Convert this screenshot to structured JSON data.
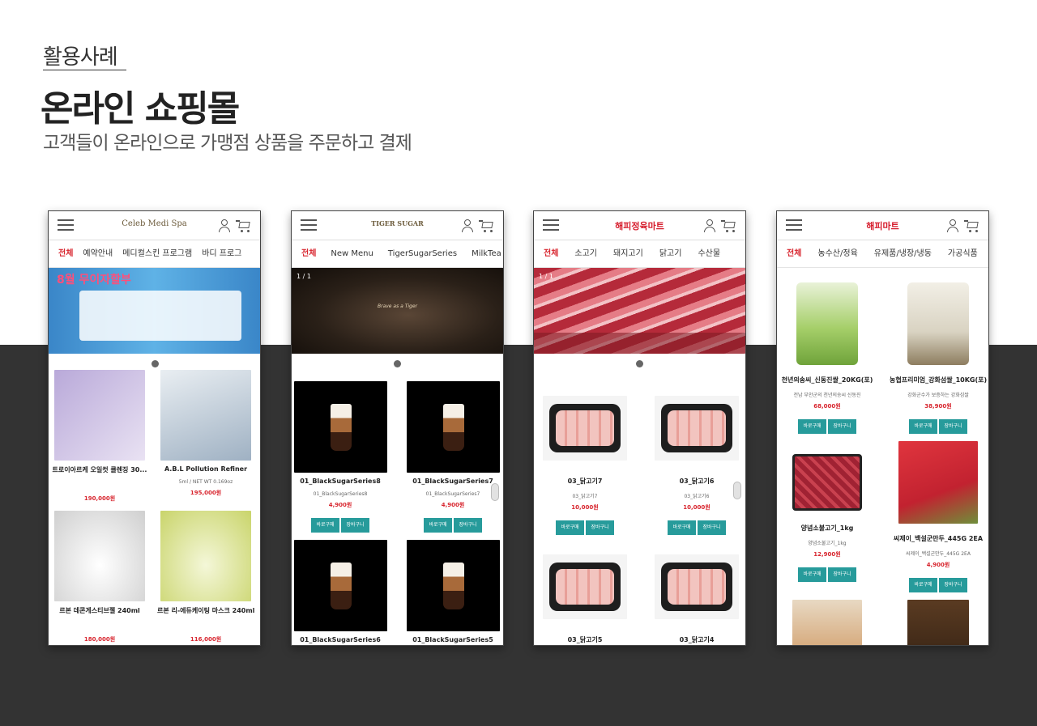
{
  "header": {
    "kicker": "활용사례",
    "title": "온라인 쇼핑몰",
    "subtitle": "고객들이 온라인으로 가맹점 상품을 주문하고 결제"
  },
  "colors": {
    "accent_red": "#d8262f",
    "button_teal": "#279b9b",
    "dark_band": "#333333"
  },
  "icons": {
    "menu": "hamburger-icon",
    "user": "user-icon",
    "cart": "cart-icon"
  },
  "phones": [
    {
      "logo": "Celeb Medi Spa",
      "nav": [
        "전체",
        "예약안내",
        "메디컬스킨 프로그램",
        "바디 프로그"
      ],
      "banner_text": "8월 무이자할부",
      "counter": "",
      "products": [
        {
          "name": "트로이아르케 오일컷 클렌징 30...",
          "desc": "",
          "price": "190,000원"
        },
        {
          "name": "A.B.L Pollution Refiner",
          "desc": "5ml / NET WT 0.169oz",
          "price": "195,000원"
        },
        {
          "name": "르본 데콘게스티브젤 240ml",
          "desc": "",
          "price": "180,000원"
        },
        {
          "name": "르본 리-에듀케이팅 마스크 240ml",
          "desc": "",
          "price": "116,000원"
        }
      ]
    },
    {
      "logo": "TIGER SUGAR",
      "nav": [
        "전체",
        "New Menu",
        "TigerSugarSeries",
        "MilkTea"
      ],
      "banner_text": "Brave as a Tiger",
      "counter": "1 / 1",
      "products": [
        {
          "name": "01_BlackSugarSeries8",
          "desc": "01_BlackSugarSeries8",
          "price": "4,900원"
        },
        {
          "name": "01_BlackSugarSeries7",
          "desc": "01_BlackSugarSeries7",
          "price": "4,900원"
        },
        {
          "name": "01_BlackSugarSeries6",
          "desc": "",
          "price": ""
        },
        {
          "name": "01_BlackSugarSeries5",
          "desc": "",
          "price": ""
        }
      ],
      "buttons": [
        "바로구매",
        "장바구니"
      ]
    },
    {
      "logo": "해피정육마트",
      "nav": [
        "전체",
        "소고기",
        "돼지고기",
        "닭고기",
        "수산물"
      ],
      "counter": "1 / 1",
      "products": [
        {
          "name": "03_닭고기7",
          "desc": "03_닭고기7",
          "price": "10,000원"
        },
        {
          "name": "03_닭고기6",
          "desc": "03_닭고기6",
          "price": "10,000원"
        },
        {
          "name": "03_닭고기5",
          "desc": "",
          "price": ""
        },
        {
          "name": "03_닭고기4",
          "desc": "",
          "price": ""
        }
      ],
      "buttons": [
        "바로구매",
        "장바구니"
      ]
    },
    {
      "logo": "해피마트",
      "nav": [
        "전체",
        "농수산/정육",
        "유제품/냉장/냉동",
        "가공식품"
      ],
      "products": [
        {
          "name": "천년의송씨_신동진쌀_20KG(포)",
          "desc": "전남 부안군의 천년의송씨 신동진",
          "price": "68,000원"
        },
        {
          "name": "농협프리미엄_강화섬쌀_10KG(포)",
          "desc": "강화군수가 보증하는 강화섬쌀",
          "price": "38,900원"
        },
        {
          "name": "양념소불고기_1kg",
          "desc": "양념소불고기_1kg",
          "price": "12,900원"
        },
        {
          "name": "씨제이_백설군만두_445G 2EA",
          "desc": "씨제이_백설군만두_445G 2EA",
          "price": "4,900원"
        },
        {
          "name": "",
          "desc": "",
          "price": ""
        },
        {
          "name": "",
          "desc": "",
          "price": ""
        }
      ],
      "buttons": [
        "바로구매",
        "장바구니"
      ]
    }
  ]
}
